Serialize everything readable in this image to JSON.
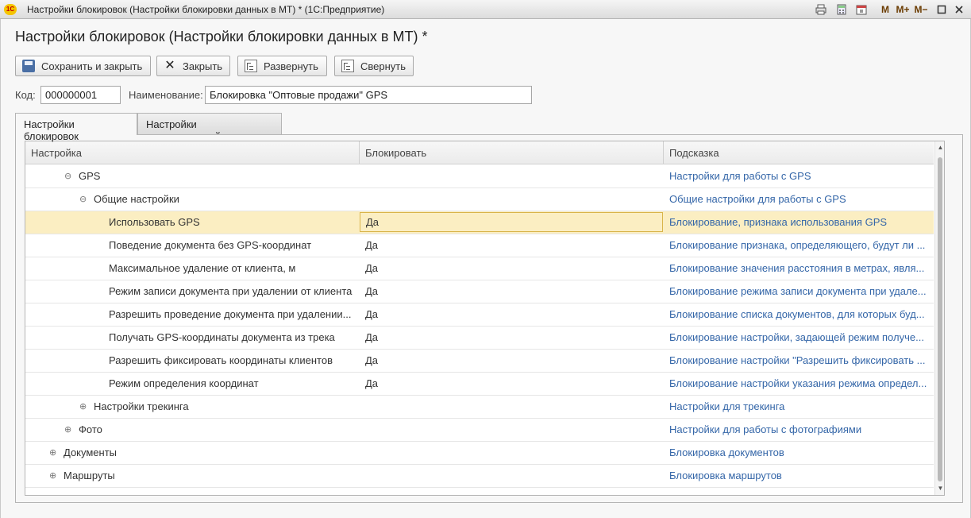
{
  "window": {
    "app_logo": "1С",
    "title": "Настройки блокировок (Настройки блокировки данных в МТ) *  (1С:Предприятие)",
    "buttons": {
      "m": "M",
      "m_plus": "M+",
      "m_minus": "M−"
    }
  },
  "form": {
    "title": "Настройки блокировок (Настройки блокировки данных в МТ) *"
  },
  "toolbar": {
    "save_close": "Сохранить и закрыть",
    "close": "Закрыть",
    "expand": "Развернуть",
    "collapse": "Свернуть"
  },
  "fields": {
    "code_label": "Код:",
    "code_value": "000000001",
    "name_label": "Наименование:",
    "name_value": "Блокировка \"Оптовые продажи\" GPS"
  },
  "tabs": [
    {
      "label": "Настройки блокировок",
      "active": true
    },
    {
      "label": "Настройки подтверждений",
      "active": false
    }
  ],
  "table": {
    "headers": [
      "Настройка",
      "Блокировать",
      "Подсказка"
    ],
    "rows": [
      {
        "name": "GPS",
        "level": 2,
        "toggle": "⊖",
        "block": "",
        "hint": "Настройки для работы с GPS"
      },
      {
        "name": "Общие настройки",
        "level": 3,
        "toggle": "⊖",
        "block": "",
        "hint": "Общие настройки для работы с GPS"
      },
      {
        "name": "Использовать GPS",
        "level": 4,
        "toggle": "",
        "block": "Да",
        "hint": "Блокирование, признака использования GPS",
        "selected": true
      },
      {
        "name": "Поведение документа без GPS-координат",
        "level": 4,
        "toggle": "",
        "block": "Да",
        "hint": "Блокирование признака, определяющего, будут ли ..."
      },
      {
        "name": "Максимальное удаление от клиента, м",
        "level": 4,
        "toggle": "",
        "block": "Да",
        "hint": "Блокирование значения расстояния в метрах, явля..."
      },
      {
        "name": "Режим записи документа при удалении от клиента",
        "level": 4,
        "toggle": "",
        "block": "Да",
        "hint": "Блокирование режима записи документа при удале..."
      },
      {
        "name": "Разрешить проведение документа при удалении...",
        "level": 4,
        "toggle": "",
        "block": "Да",
        "hint": "Блокирование списка документов, для которых буд..."
      },
      {
        "name": "Получать GPS-координаты документа из трека",
        "level": 4,
        "toggle": "",
        "block": "Да",
        "hint": "Блокирование настройки, задающей режим получе..."
      },
      {
        "name": "Разрешить фиксировать координаты клиентов",
        "level": 4,
        "toggle": "",
        "block": "Да",
        "hint": "Блокирование настройки \"Разрешить фиксировать ..."
      },
      {
        "name": "Режим определения координат",
        "level": 4,
        "toggle": "",
        "block": "Да",
        "hint": "Блокирование настройки указания режима определ..."
      },
      {
        "name": "Настройки трекинга",
        "level": 3,
        "toggle": "⊕",
        "block": "",
        "hint": "Настройки для трекинга"
      },
      {
        "name": "Фото",
        "level": 2,
        "toggle": "⊕",
        "block": "",
        "hint": "Настройки для работы с фотографиями"
      },
      {
        "name": "Документы",
        "level": 1,
        "toggle": "⊕",
        "block": "",
        "hint": "Блокировка документов"
      },
      {
        "name": "Маршруты",
        "level": 1,
        "toggle": "⊕",
        "block": "",
        "hint": "Блокировка маршрутов"
      }
    ]
  },
  "colors": {
    "hint_link": "#3466a8",
    "selected_row": "#fbeec2",
    "selected_cell_border": "#d9b44a"
  }
}
